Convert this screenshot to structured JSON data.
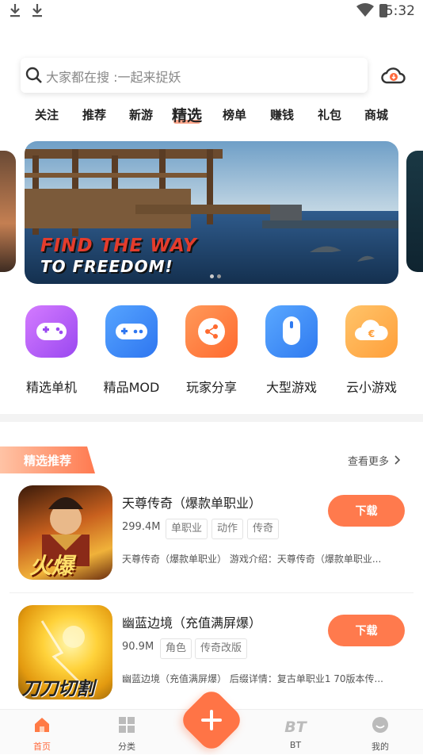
{
  "status_bar": {
    "time": "5:32"
  },
  "search": {
    "placeholder": "大家都在搜 :一起来捉妖"
  },
  "tabs": [
    "关注",
    "推荐",
    "新游",
    "精选",
    "榜单",
    "赚钱",
    "礼包",
    "商城"
  ],
  "active_tab": "精选",
  "banner": {
    "headline": "FIND THE WAY",
    "subline": "TO FREEDOM!"
  },
  "shortcuts": [
    {
      "label": "精选单机",
      "icon": "gamepad-icon",
      "color": "#b15cff"
    },
    {
      "label": "精品MOD",
      "icon": "controller-icon",
      "color": "#3f8cff"
    },
    {
      "label": "玩家分享",
      "icon": "share-icon",
      "color": "#ff7a3d"
    },
    {
      "label": "大型游戏",
      "icon": "mouse-icon",
      "color": "#3e8cff"
    },
    {
      "label": "云小游戏",
      "icon": "cloud-game-icon",
      "color": "#ffa53d"
    }
  ],
  "section": {
    "title": "精选推荐",
    "more": "查看更多"
  },
  "games": [
    {
      "name": "天尊传奇（爆款单职业）",
      "size": "299.4M",
      "tags": [
        "单职业",
        "动作",
        "传奇"
      ],
      "desc": "天尊传奇（爆款单职业） 游戏介绍：天尊传奇（爆款单职业...",
      "button": "下载",
      "thumb_text": "火爆"
    },
    {
      "name": "幽蓝边境（充值满屏爆）",
      "size": "90.9M",
      "tags": [
        "角色",
        "传奇改版"
      ],
      "desc": "幽蓝边境（充值满屏爆） 后缀详情：复古单职业1 70版本传...",
      "button": "下载",
      "thumb_text": "刀刀切割"
    }
  ],
  "bottom_nav": [
    {
      "label": "首页",
      "icon": "home-icon"
    },
    {
      "label": "分类",
      "icon": "grid-icon"
    },
    {
      "label": "BT",
      "icon": "bt-icon"
    },
    {
      "label": "我的",
      "icon": "profile-icon"
    }
  ],
  "colors": {
    "accent": "#ff7446"
  }
}
